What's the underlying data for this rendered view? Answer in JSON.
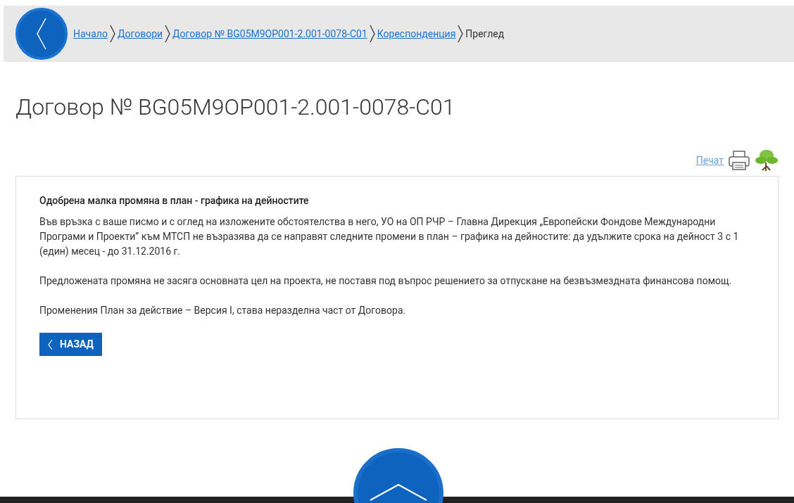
{
  "breadcrumb": [
    {
      "label": "Начало",
      "kind": "link"
    },
    {
      "label": "Договори",
      "kind": "link"
    },
    {
      "label": "Договор № BG05M9OP001-2.001-0078-C01",
      "kind": "link"
    },
    {
      "label": "Кореспонденция",
      "kind": "link"
    },
    {
      "label": "Преглед",
      "kind": "current"
    }
  ],
  "page_title": "Договор № BG05M9OP001-2.001-0078-C01",
  "print_link": "Печат",
  "message": {
    "subject": "Одобрена малка промяна в план - графика на дейностите",
    "paragraphs": [
      "Във връзка с ваше писмо и с оглед на изложените обстоятелства в него, УО на ОП РЧР – Главна Дирекция „Европейски Фондове Международни Програми и Проекти” към МТСП не възразява да се направят следните промени в план – графика на дейностите: да удължите срока на дейност 3 с 1 (един) месец - до 31.12.2016 г.",
      "Предложената промяна не засяга основната цел на проекта, не поставя под въпрос решението за отпускане на безвъзмездната финансова помощ.",
      "Променения План за действие – Версия I, става неразделна част от Договора."
    ]
  },
  "back_button": "НАЗАД"
}
